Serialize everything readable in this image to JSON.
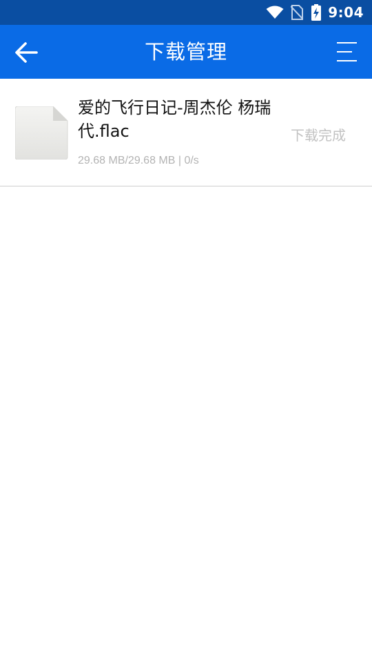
{
  "status_bar": {
    "time": "9:04",
    "icons": [
      "wifi-icon",
      "no-sim-icon",
      "battery-charging-icon"
    ]
  },
  "app_bar": {
    "title": "下载管理",
    "back_icon": "arrow-left-icon",
    "menu_icon": "menu-lines-icon"
  },
  "downloads": [
    {
      "name": "爱的飞行日记-周杰伦  杨瑞代.flac",
      "progress": "29.68 MB/29.68 MB | 0/s",
      "status": "下载完成",
      "icon": "file-icon"
    }
  ],
  "colors": {
    "status_bar": "#0a4ea2",
    "app_bar": "#0a6be6",
    "background": "#ffffff",
    "muted_text": "#b3b3b3"
  }
}
